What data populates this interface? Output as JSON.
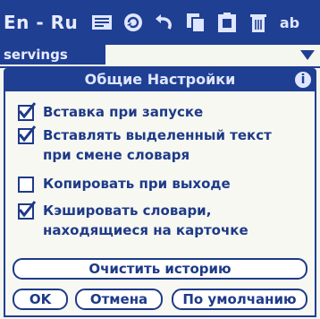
{
  "app": {
    "title": "En - Ru"
  },
  "toolbar": {
    "icons": [
      "dictionary-icon",
      "refresh-icon",
      "undo-icon",
      "copy-icon",
      "paste-icon",
      "delete-icon",
      "abc-icon"
    ],
    "abc_text": "ab"
  },
  "search": {
    "value": "servings"
  },
  "dialog": {
    "title": "Общие Настройки",
    "info_symbol": "i",
    "options": [
      {
        "label": "Вставка при запуске",
        "checked": true
      },
      {
        "label": "Вставлять выделенный текст",
        "label2": "при смене словаря",
        "checked": true
      },
      {
        "label": "Копировать при выходе",
        "checked": false
      },
      {
        "label": "Кэшировать словари,",
        "label2": "находящиеся на карточке",
        "checked": true
      }
    ],
    "clear_history_label": "Очистить историю",
    "ok_label": "OK",
    "cancel_label": "Отмена",
    "default_label": "По умолчанию"
  },
  "colors": {
    "accent": "#1f3f93",
    "text": "#1e3a88",
    "background": "#f4f6f0"
  }
}
